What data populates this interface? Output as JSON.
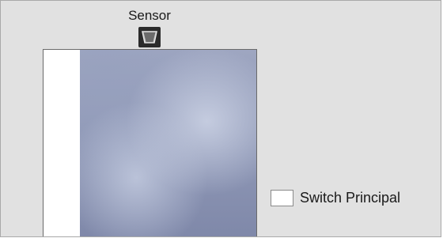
{
  "sensor": {
    "label": "Sensor",
    "icon": "sensor-icon"
  },
  "tank": {
    "fill_color": "#9ea6c1"
  },
  "switch": {
    "label": "Switch Principal",
    "checked": false
  },
  "colors": {
    "panel_background": "#e1e1e1",
    "border": "#a9a9a9",
    "icon_dark": "#2b2b2b"
  }
}
